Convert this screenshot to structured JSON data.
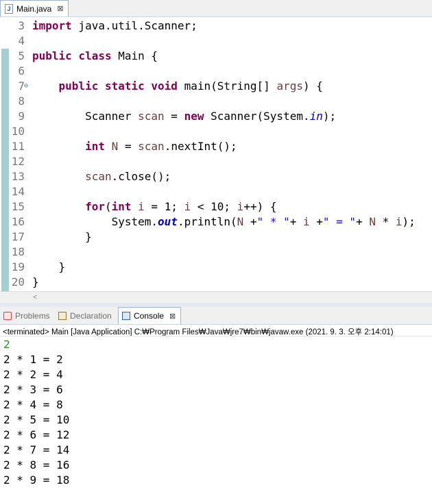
{
  "editor": {
    "tab": {
      "label": "Main.java",
      "close": "⊠"
    },
    "lines": [
      {
        "n": "3",
        "parts": [
          [
            "kw",
            "import"
          ],
          [
            "t",
            " java.util.Scanner;"
          ]
        ]
      },
      {
        "n": "4",
        "parts": []
      },
      {
        "n": "5",
        "parts": [
          [
            "kw",
            "public"
          ],
          [
            "t",
            " "
          ],
          [
            "kw",
            "class"
          ],
          [
            "t",
            " Main {"
          ]
        ]
      },
      {
        "n": "6",
        "parts": []
      },
      {
        "n": "7",
        "fold": "⊖",
        "parts": [
          [
            "t",
            "    "
          ],
          [
            "kw",
            "public"
          ],
          [
            "t",
            " "
          ],
          [
            "kw",
            "static"
          ],
          [
            "t",
            " "
          ],
          [
            "kw",
            "void"
          ],
          [
            "t",
            " main(String[] "
          ],
          [
            "var",
            "args"
          ],
          [
            "t",
            ") {"
          ]
        ]
      },
      {
        "n": "8",
        "parts": []
      },
      {
        "n": "9",
        "parts": [
          [
            "t",
            "        Scanner "
          ],
          [
            "var",
            "scan"
          ],
          [
            "t",
            " = "
          ],
          [
            "kw",
            "new"
          ],
          [
            "t",
            " Scanner(System."
          ],
          [
            "fld",
            "in"
          ],
          [
            "t",
            ");"
          ]
        ]
      },
      {
        "n": "10",
        "parts": []
      },
      {
        "n": "11",
        "parts": [
          [
            "t",
            "        "
          ],
          [
            "kw",
            "int"
          ],
          [
            "t",
            " "
          ],
          [
            "var",
            "N"
          ],
          [
            "t",
            " = "
          ],
          [
            "var",
            "scan"
          ],
          [
            "t",
            ".nextInt();"
          ]
        ]
      },
      {
        "n": "12",
        "parts": []
      },
      {
        "n": "13",
        "parts": [
          [
            "t",
            "        "
          ],
          [
            "var",
            "scan"
          ],
          [
            "t",
            ".close();"
          ]
        ]
      },
      {
        "n": "14",
        "parts": []
      },
      {
        "n": "15",
        "parts": [
          [
            "t",
            "        "
          ],
          [
            "kw",
            "for"
          ],
          [
            "t",
            "("
          ],
          [
            "kw",
            "int"
          ],
          [
            "t",
            " "
          ],
          [
            "var",
            "i"
          ],
          [
            "t",
            " = 1; "
          ],
          [
            "var",
            "i"
          ],
          [
            "t",
            " < 10; "
          ],
          [
            "var",
            "i"
          ],
          [
            "t",
            "++) {"
          ]
        ]
      },
      {
        "n": "16",
        "parts": [
          [
            "t",
            "            System."
          ],
          [
            "sfld",
            "out"
          ],
          [
            "t",
            ".println("
          ],
          [
            "var",
            "N"
          ],
          [
            "t",
            " +"
          ],
          [
            "str",
            "\" * \""
          ],
          [
            "t",
            "+ "
          ],
          [
            "var",
            "i"
          ],
          [
            "t",
            " +"
          ],
          [
            "str",
            "\" = \""
          ],
          [
            "t",
            "+ "
          ],
          [
            "var",
            "N"
          ],
          [
            "t",
            " * "
          ],
          [
            "var",
            "i"
          ],
          [
            "t",
            ");"
          ]
        ]
      },
      {
        "n": "17",
        "parts": [
          [
            "t",
            "        }"
          ]
        ]
      },
      {
        "n": "18",
        "parts": []
      },
      {
        "n": "19",
        "parts": [
          [
            "t",
            "    }"
          ]
        ]
      },
      {
        "n": "20",
        "parts": [
          [
            "t",
            "}"
          ]
        ]
      }
    ],
    "scroll_left_arrow": "<"
  },
  "panel": {
    "tabs": [
      {
        "label": "Problems",
        "icon": "problems-icon",
        "active": false
      },
      {
        "label": "Declaration",
        "icon": "declaration-icon",
        "active": false
      },
      {
        "label": "Console",
        "icon": "console-icon",
        "active": true,
        "close": "⊠"
      }
    ],
    "console_header": "<terminated> Main [Java Application] C:₩Program Files₩Java₩jre7₩bin₩javaw.exe (2021. 9. 3. 오후 2:14:01)",
    "input_line": "2",
    "output_lines": [
      "2 * 1 = 2",
      "2 * 2 = 4",
      "2 * 3 = 6",
      "2 * 4 = 8",
      "2 * 5 = 10",
      "2 * 6 = 12",
      "2 * 7 = 14",
      "2 * 8 = 16",
      "2 * 9 = 18"
    ]
  },
  "colors": {
    "keyword": "#7f0055",
    "local_variable": "#6a3e3e",
    "string": "#2a00ff",
    "field": "#0000c0",
    "console_input": "#1a9a1a"
  }
}
